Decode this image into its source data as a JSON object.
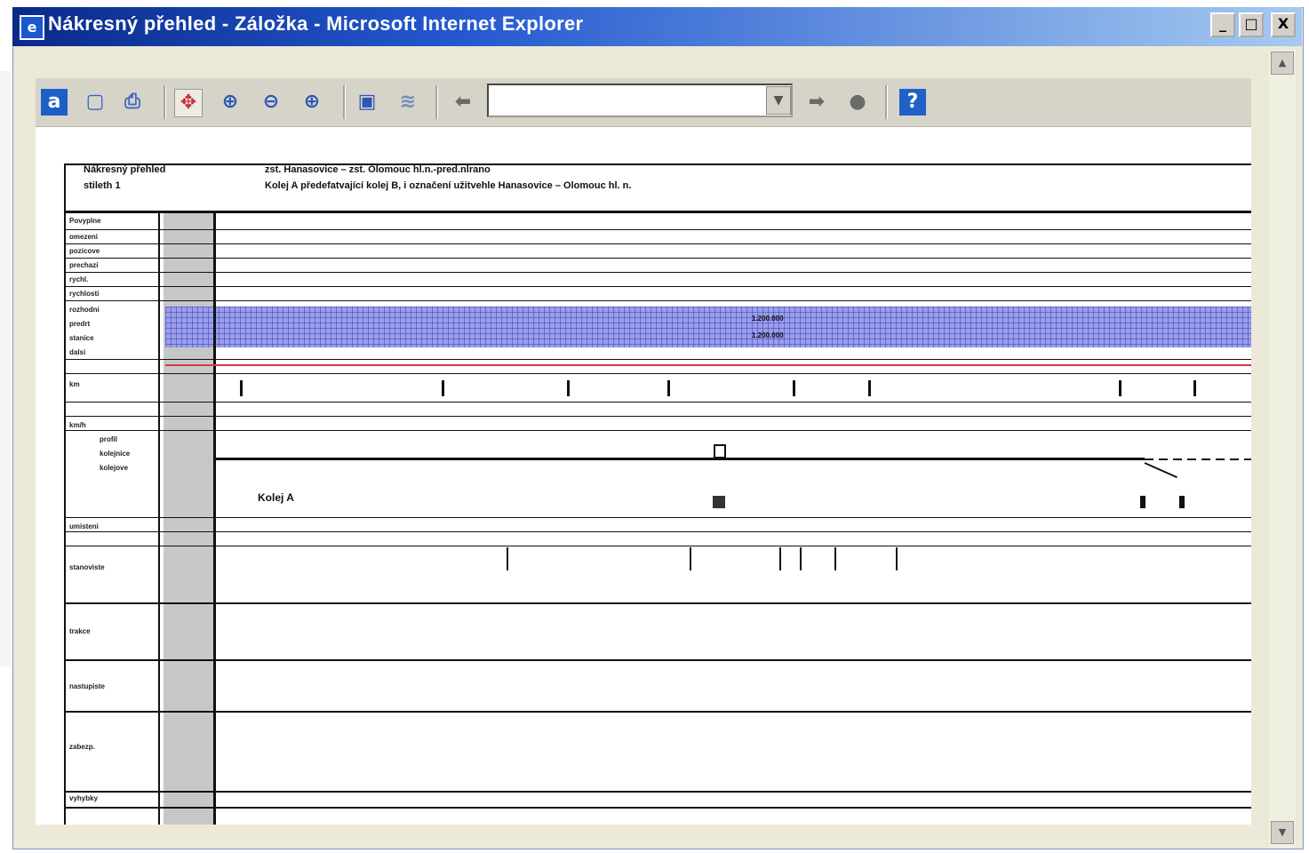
{
  "window": {
    "title": "Nákresný přehled - Záložka - Microsoft Internet Explorer",
    "buttons": {
      "minimize": "_",
      "maximize": "□",
      "close": "X"
    }
  },
  "toolbar": {
    "icons": [
      "text-a-icon",
      "page-icon",
      "print-icon",
      "select-icon",
      "zoom-fit-icon",
      "zoom-out-icon",
      "zoom-in-icon",
      "save-icon",
      "layers-icon",
      "back-icon",
      "go-icon",
      "stop-icon",
      "help-icon"
    ],
    "nav_value": "",
    "help_label": "?"
  },
  "document": {
    "header_left_line1": "Nákresný přehled",
    "header_left_line2": "stileth 1",
    "header_right_line1": "zst. Hanasovice – zst. Olomouc hl.n.-pred.nlrano",
    "header_right_line2": "Kolej A předefatvající kolej B, i označení užitvehle Hanasovice – Olomouc hl. n.",
    "track_label": "Kolej A",
    "grid_band_label_1": "1.200.000",
    "grid_band_label_2": "1.200.000",
    "row_labels": [
      "Povyplne",
      "omezeni",
      "pozicove",
      "prechazi",
      "rychl.",
      "rychlosti",
      "rozhodni",
      "predrt",
      "stanice",
      "dalsi",
      "km",
      "km/h",
      "profil",
      "kolejnice",
      "kolejove",
      "umisteni",
      "stanoviste",
      "trakce",
      "nastupiste",
      "zabezp.",
      "vyhybky"
    ]
  },
  "colors": {
    "titlebar_start": "#0a2a8a",
    "titlebar_end": "#a6caf0",
    "grid_band": "#9b9fe6",
    "red_line": "#d23b3b"
  }
}
